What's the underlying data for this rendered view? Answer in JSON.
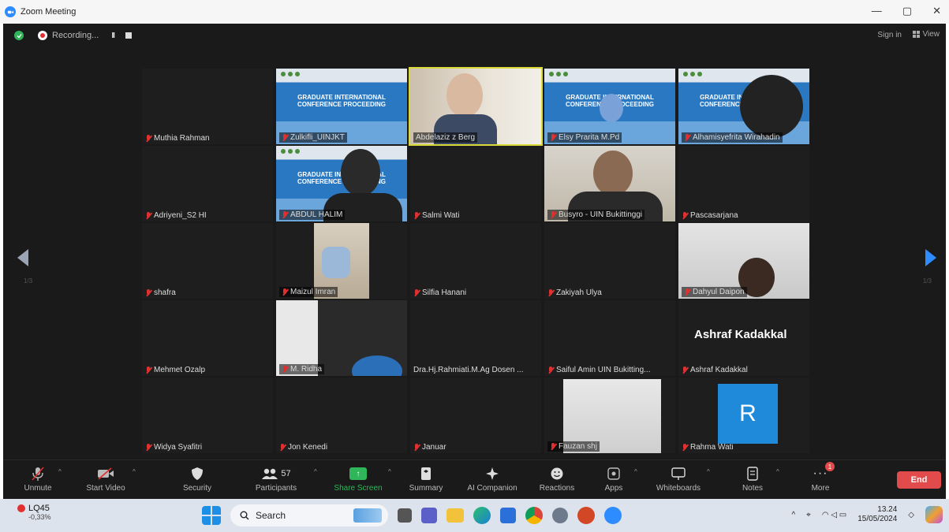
{
  "window": {
    "title": "Zoom Meeting",
    "controls": [
      "—",
      "▢",
      "✕"
    ]
  },
  "topbar": {
    "recording_label": "Recording...",
    "pause_glyph": "II",
    "signin": "Sign in",
    "view": "View"
  },
  "tiles": [
    {
      "name": "Muthia Rahman"
    },
    {
      "name": "Zulkifli_UINJKT"
    },
    {
      "name": "Abdelaziz z Berg"
    },
    {
      "name": "Elsy Prarita M.Pd"
    },
    {
      "name": "Alhamisyefrita Wirahadin"
    },
    {
      "name": "Adriyeni_S2 HI"
    },
    {
      "name": "ABDUL HALIM"
    },
    {
      "name": "Salmi Wati"
    },
    {
      "name": "Busyro - UIN Bukittinggi"
    },
    {
      "name": "Pascasarjana"
    },
    {
      "name": "shafra"
    },
    {
      "name": "Maizul Imran"
    },
    {
      "name": "Silfia Hanani"
    },
    {
      "name": "Zakiyah Ulya"
    },
    {
      "name": "Dahyul Daipon"
    },
    {
      "name": "Mehmet Ozalp"
    },
    {
      "name": "M. Ridha"
    },
    {
      "name": "Dra.Hj.Rahmiati.M.Ag Dosen ..."
    },
    {
      "name": "Saiful Amin UIN Bukitting..."
    },
    {
      "name": "Ashraf Kadakkal"
    },
    {
      "name": "Widya Syafitri"
    },
    {
      "name": "Jon Kenedi"
    },
    {
      "name": "Januar"
    },
    {
      "name": "Fauzan shj"
    },
    {
      "name": "Rahma Wati"
    }
  ],
  "poster_text": "GRADUATE INTERNATIONAL CONFERENCE PROCEEDING",
  "spotlight_name": "Ashraf Kadakkal",
  "avatar_letter": "R",
  "toolbar": {
    "unmute": "Unmute",
    "start_video": "Start Video",
    "security": "Security",
    "participants": "Participants",
    "participant_count": "57",
    "share_screen": "Share Screen",
    "summary": "Summary",
    "ai_companion": "AI Companion",
    "reactions": "Reactions",
    "apps": "Apps",
    "whiteboards": "Whiteboards",
    "notes": "Notes",
    "more": "More",
    "more_badge": "1",
    "end": "End"
  },
  "taskbar": {
    "weather_name": "LQ45",
    "weather_value": "-0,33%",
    "search": "Search",
    "time": "13.24",
    "date": "15/05/2024"
  },
  "colors": {
    "accent": "#2d8cff",
    "end": "#e24b4b",
    "share": "#2fb55a",
    "muted": "#e0302f"
  }
}
